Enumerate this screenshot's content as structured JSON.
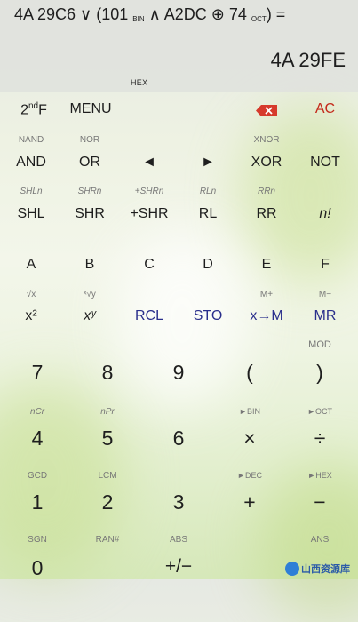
{
  "display": {
    "expr_parts": {
      "p1": "4A 29C6 ∨ (101 ",
      "s1": "BIN",
      "p2": " ∧ A2DC ⊕ 74 ",
      "s2": "OCT",
      "p3": ") ="
    },
    "result": "4A 29FE",
    "mode": "HEX"
  },
  "topbar": {
    "second": {
      "main": "2",
      "sup": "nd",
      "tail": "F"
    },
    "menu": "MENU",
    "backspace_icon": "backspace-icon",
    "ac": "AC"
  },
  "rows": {
    "r1": {
      "nand": "NAND",
      "nor": "NOR",
      "xnor": "XNOR",
      "and": "AND",
      "or": "OR",
      "left": "◄",
      "right": "►",
      "xor": "XOR",
      "not": "NOT"
    },
    "r2": {
      "shln": "SHLn",
      "shrn": "SHRn",
      "pshrn": "+SHRn",
      "rln": "RLn",
      "rrn": "RRn",
      "shl": "SHL",
      "shr": "SHR",
      "pshr": "+SHR",
      "rl": "RL",
      "rr": "RR",
      "fact": "n!"
    },
    "r3": {
      "a": "A",
      "b": "B",
      "c": "C",
      "d": "D",
      "e": "E",
      "f": "F"
    },
    "r4": {
      "sqrt": "√x",
      "yroot": "ˣ√y",
      "mplus": "M+",
      "mminus": "M−",
      "x2": "x²",
      "xy": "xʸ",
      "rcl": "RCL",
      "sto": "STO",
      "xm": "x→M",
      "mr": "MR"
    },
    "r5": {
      "mod": "MOD",
      "k7": "7",
      "k8": "8",
      "k9": "9",
      "lp": "(",
      "rp": ")"
    },
    "r6": {
      "ncr": "nCr",
      "npr": "nPr",
      "tobin": "►BIN",
      "tooct": "►OCT",
      "k4": "4",
      "k5": "5",
      "k6": "6",
      "mul": "×",
      "div": "÷"
    },
    "r7": {
      "gcd": "GCD",
      "lcm": "LCM",
      "todec": "►DEC",
      "tohex": "►HEX",
      "k1": "1",
      "k2": "2",
      "k3": "3",
      "add": "+",
      "sub": "−"
    },
    "r8": {
      "sgn": "SGN",
      "ran": "RAN#",
      "abs": "ABS",
      "ans": "ANS",
      "k0": "0",
      "pm": "+/−"
    }
  },
  "watermark": {
    "text": "山西资源库"
  },
  "colors": {
    "accent_blue": "#2a2f8c",
    "accent_red": "#c4291a",
    "backspace_red": "#d63a2c"
  }
}
